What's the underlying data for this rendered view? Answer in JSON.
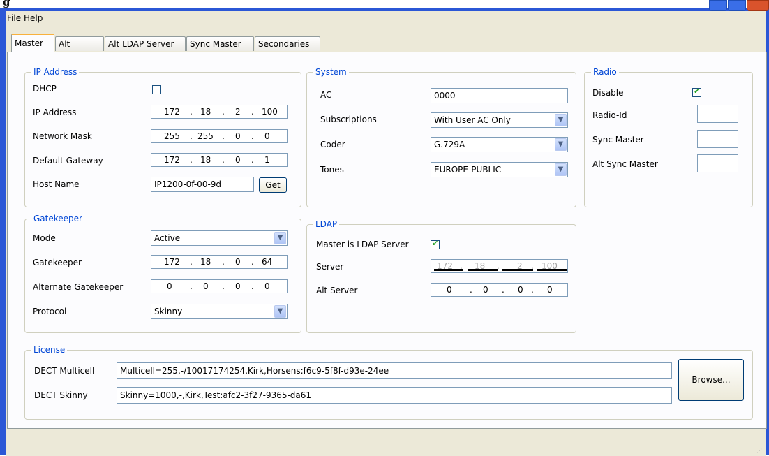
{
  "window": {
    "title": "g"
  },
  "menu": [
    "File",
    "Help"
  ],
  "tabs": [
    "Master",
    "Alt Master",
    "Alt LDAP Server",
    "Sync Master",
    "Secondaries"
  ],
  "ip_group": {
    "title": "IP Address",
    "dhcp_label": "DHCP",
    "dhcp_checked": false,
    "ip_label": "IP Address",
    "ip": [
      "172",
      "18",
      "2",
      "100"
    ],
    "mask_label": "Network Mask",
    "mask": [
      "255",
      "255",
      "0",
      "0"
    ],
    "gw_label": "Default Gateway",
    "gw": [
      "172",
      "18",
      "0",
      "1"
    ],
    "host_label": "Host Name",
    "host_value": "IP1200-0f-00-9d",
    "get_label": "Get"
  },
  "system_group": {
    "title": "System",
    "ac_label": "AC",
    "ac_value": "0000",
    "subs_label": "Subscriptions",
    "subs_value": "With User AC Only",
    "coder_label": "Coder",
    "coder_value": "G.729A",
    "tones_label": "Tones",
    "tones_value": "EUROPE-PUBLIC"
  },
  "radio_group": {
    "title": "Radio",
    "disable_label": "Disable",
    "disable_checked": true,
    "radioid_label": "Radio-Id",
    "radioid_value": "",
    "sync_label": "Sync Master",
    "sync_value": "",
    "altsync_label": "Alt Sync Master",
    "altsync_value": ""
  },
  "gk_group": {
    "title": "Gatekeeper",
    "mode_label": "Mode",
    "mode_value": "Active",
    "gk_label": "Gatekeeper",
    "gk": [
      "172",
      "18",
      "0",
      "64"
    ],
    "altgk_label": "Alternate Gatekeeper",
    "altgk": [
      "0",
      "0",
      "0",
      "0"
    ],
    "proto_label": "Protocol",
    "proto_value": "Skinny"
  },
  "ldap_group": {
    "title": "LDAP",
    "master_label": "Master is LDAP Server",
    "master_checked": true,
    "server_label": "Server",
    "server": [
      "172",
      "18",
      "2",
      "100"
    ],
    "altserver_label": "Alt Server",
    "altserver": [
      "0",
      "0",
      "0",
      "0"
    ]
  },
  "license_group": {
    "title": "License",
    "multicell_label": "DECT Multicell",
    "multicell_value": "Multicell=255,-/10017174254,Kirk,Horsens:f6c9-5f8f-d93e-24ee",
    "skinny_label": "DECT Skinny",
    "skinny_value": "Skinny=1000,-,Kirk,Test:afc2-3f27-9365-da61",
    "browse_label": "Browse..."
  },
  "icons": {
    "combo_arrow": "chevron-down-icon",
    "check": "checkmark-icon"
  },
  "colors": {
    "group_title": "#0046d5",
    "frame": "#2b57d6",
    "client_bg": "#ece9d8",
    "page_bg": "#fcfcfe",
    "check": "#21a121"
  }
}
